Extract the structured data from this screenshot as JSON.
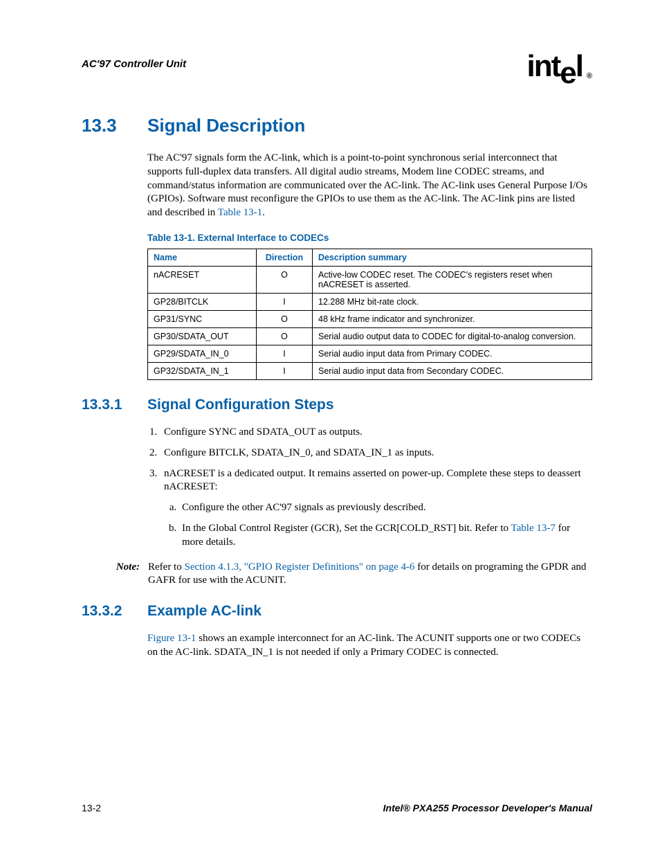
{
  "header": {
    "section_title": "AC'97 Controller Unit",
    "logo_text": "intel",
    "logo_reg": "®"
  },
  "sections": {
    "s13_3": {
      "number": "13.3",
      "title": "Signal Description",
      "para": "The AC'97 signals form the AC-link, which is a point-to-point synchronous serial interconnect that supports full-duplex data transfers. All digital audio streams, Modem line CODEC streams, and command/status information are communicated over the AC-link. The AC-link uses General Purpose I/Os (GPIOs). Software must reconfigure the GPIOs to use them as the AC-link. The AC-link pins are listed and described in ",
      "para_link": "Table 13-1",
      "para_tail": "."
    },
    "table": {
      "caption": "Table 13-1. External Interface to CODECs",
      "cols": {
        "name": "Name",
        "direction": "Direction",
        "desc": "Description summary"
      },
      "rows": [
        {
          "name": "nACRESET",
          "dir": "O",
          "desc": "Active-low CODEC reset. The CODEC's registers reset when nACRESET is asserted."
        },
        {
          "name": "GP28/BITCLK",
          "dir": "I",
          "desc": "12.288 MHz bit-rate clock."
        },
        {
          "name": "GP31/SYNC",
          "dir": "O",
          "desc": "48 kHz frame indicator and synchronizer."
        },
        {
          "name": "GP30/SDATA_OUT",
          "dir": "O",
          "desc": "Serial audio output data to CODEC for digital-to-analog conversion."
        },
        {
          "name": "GP29/SDATA_IN_0",
          "dir": "I",
          "desc": "Serial audio input data from Primary CODEC."
        },
        {
          "name": "GP32/SDATA_IN_1",
          "dir": "I",
          "desc": "Serial audio input data from Secondary CODEC."
        }
      ]
    },
    "s13_3_1": {
      "number": "13.3.1",
      "title": "Signal Configuration Steps",
      "steps": {
        "s1": "Configure SYNC and SDATA_OUT as outputs.",
        "s2": "Configure BITCLK, SDATA_IN_0, and SDATA_IN_1 as inputs.",
        "s3": "nACRESET is a dedicated output. It remains asserted on power-up. Complete these steps to deassert nACRESET:",
        "s3a": "Configure the other AC'97 signals as previously described.",
        "s3b_pre": "In the Global Control Register (GCR), Set the GCR[COLD_RST] bit. Refer to ",
        "s3b_link": "Table 13-7",
        "s3b_post": " for more details."
      },
      "note": {
        "label": "Note:",
        "pre": "Refer to ",
        "link": "Section 4.1.3, \"GPIO Register Definitions\" on page 4-6",
        "post": " for details on programing the GPDR and GAFR for use with the ACUNIT."
      }
    },
    "s13_3_2": {
      "number": "13.3.2",
      "title": "Example AC-link",
      "para_link": "Figure 13-1",
      "para": " shows an example interconnect for an AC-link. The ACUNIT supports one or two CODECs on the AC-link. SDATA_IN_1 is not needed if only a Primary CODEC is connected."
    }
  },
  "footer": {
    "page": "13-2",
    "manual": "Intel® PXA255 Processor Developer's Manual"
  }
}
